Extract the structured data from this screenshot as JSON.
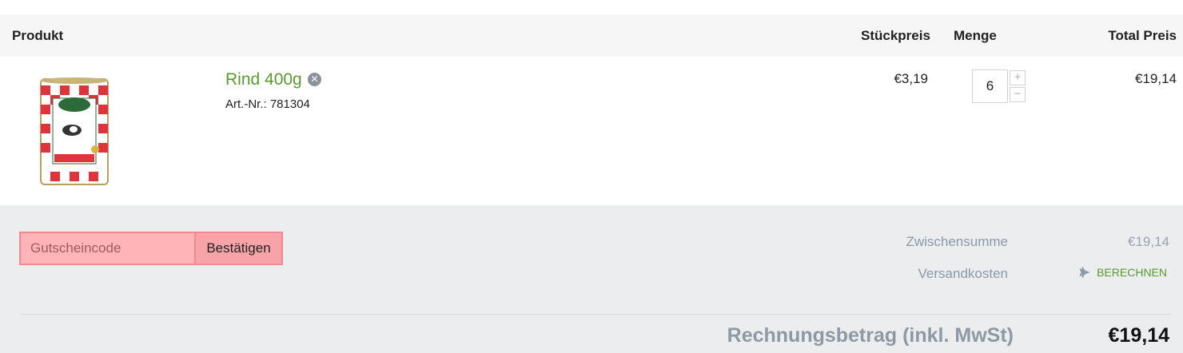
{
  "table_header": {
    "product": "Produkt",
    "unit_price": "Stückpreis",
    "quantity": "Menge",
    "total_price": "Total Preis"
  },
  "item": {
    "name": "Rind 400g",
    "article_number": "Art.-Nr.: 781304",
    "unit_price": "€3,19",
    "quantity": "6",
    "total": "€19,14",
    "image_icon": "dog-food-can-image",
    "remove_icon": "remove-circle-icon"
  },
  "voucher": {
    "placeholder": "Gutscheincode",
    "button_label": "Bestätigen"
  },
  "summary": {
    "subtotal_label": "Zwischensumme",
    "subtotal_value": "€19,14",
    "shipping_label": "Versandkosten",
    "shipping_action": "BERECHNEN",
    "shipping_icon": "airplane-icon",
    "grand_total_label": "Rechnungsbetrag (inkl. MwSt)",
    "grand_total_value": "€19,14"
  },
  "colors": {
    "accent_green": "#5a9a2e",
    "voucher_bg": "#ffb5b7",
    "summary_bg": "#ecedef",
    "header_bg": "#f6f6f7"
  }
}
